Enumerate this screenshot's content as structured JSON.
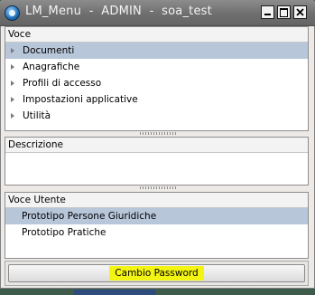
{
  "window": {
    "title": "LM_Menu  -  ADMIN  -  soa_test",
    "controls": [
      "minimize",
      "maximize",
      "close"
    ]
  },
  "voce_panel": {
    "header": "Voce",
    "items": [
      {
        "label": "Documenti",
        "selected": true
      },
      {
        "label": "Anagrafiche",
        "selected": false
      },
      {
        "label": "Profili di accesso",
        "selected": false
      },
      {
        "label": "Impostazioni applicative",
        "selected": false
      },
      {
        "label": "Utilità",
        "selected": false
      }
    ]
  },
  "descrizione_panel": {
    "header": "Descrizione",
    "text": ""
  },
  "voce_utente_panel": {
    "header": "Voce Utente",
    "items": [
      {
        "label": "Prototipo Persone Giuridiche",
        "selected": true
      },
      {
        "label": "Prototipo Pratiche",
        "selected": false
      }
    ]
  },
  "actions": {
    "cambio_password_label": "Cambio Password",
    "highlight_color": "#f4f413"
  },
  "colors": {
    "selection": "#b8c6da",
    "titlebar": "#6f6f6f"
  }
}
